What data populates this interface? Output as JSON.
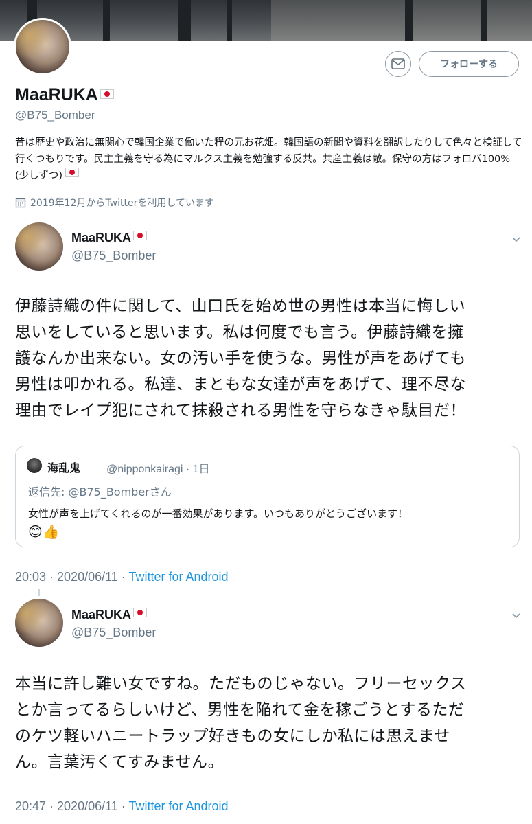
{
  "profile": {
    "display_name": "MaaRUKA",
    "handle": "@B75_Bomber",
    "bio": "昔は歴史や政治に無関心で韓国企業で働いた程の元お花畑。韓国語の新聞や資料を翻訳したりして色々と検証して行くつもりです。民主主義を守る為にマルクス主義を勉強する反共。共産主義は敵。保守の方はフォロバ100%(少しずつ)",
    "joined": "2019年12月からTwitterを利用しています",
    "follow_label": "フォローする"
  },
  "tweets": [
    {
      "display_name": "MaaRUKA",
      "handle": "@B75_Bomber",
      "text_lines": [
        "伊藤詩織の件に関して、山口氏を始め世の男性は本当に悔しい",
        "思いをしていると思います。私は何度でも言う。伊藤詩織を擁",
        "護なんか出来ない。女の汚い手を使うな。男性が声をあげても",
        "男性は叩かれる。私達、まともな女達が声をあげて、理不尽な",
        "理由でレイプ犯にされて抹殺される男性を守らなきゃ駄目だ！"
      ],
      "quote": {
        "name": "海乱鬼",
        "meta": "@nipponkairagi · 1日",
        "reply_to": "返信先: @B75_Bomberさん",
        "text": "女性が声を上げてくれるのが一番効果があります。いつもありがとうございます！",
        "emoji": "😊👍"
      },
      "time": "20:03 · 2020/06/11 · ",
      "source": "Twitter for Android"
    },
    {
      "display_name": "MaaRUKA",
      "handle": "@B75_Bomber",
      "text_lines": [
        "本当に許し難い女ですね。ただものじゃない。フリーセックス",
        "とか言ってるらしいけど、男性を陥れて金を稼ごうとするただ",
        "のケツ軽いハニートラップ好きもの女にしか私には思えませ",
        "ん。言葉汚くてすみません。"
      ],
      "time": "20:47 · 2020/06/11 · ",
      "source": "Twitter for Android"
    }
  ],
  "icons": {
    "dm": "envelope-icon",
    "calendar": "calendar-icon",
    "caret": "chevron-down-icon"
  },
  "colors": {
    "secondary_text": "#657786",
    "link": "#1b95e0",
    "border": "#ccd6dd",
    "flag_red": "#d60e28"
  }
}
